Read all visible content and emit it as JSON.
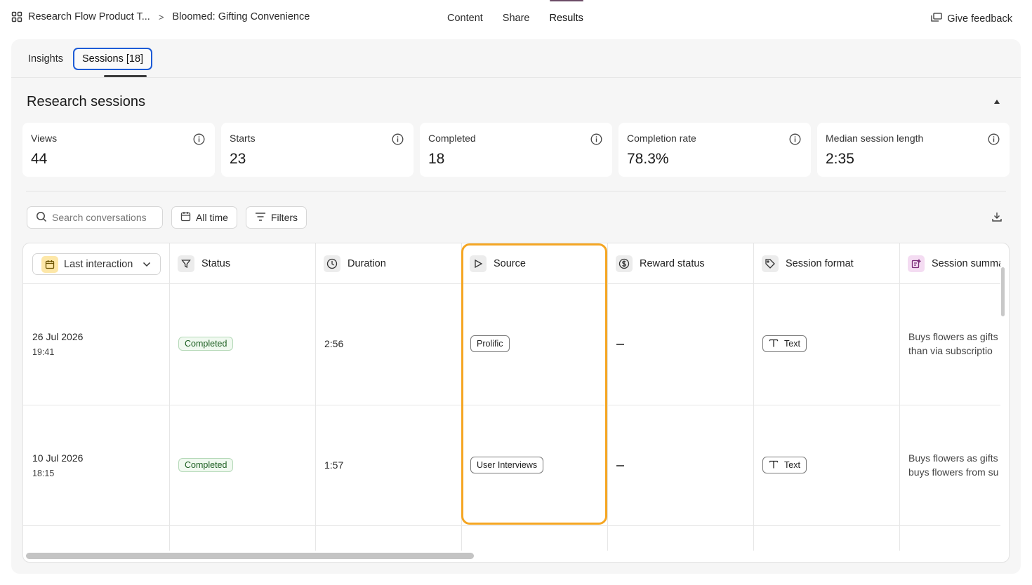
{
  "breadcrumb": {
    "project": "Research Flow Product T...",
    "separator": ">",
    "study": "Bloomed: Gifting Convenience"
  },
  "nav": {
    "tabs": [
      {
        "label": "Content",
        "active": false
      },
      {
        "label": "Share",
        "active": false
      },
      {
        "label": "Results",
        "active": true
      }
    ],
    "feedback_label": "Give feedback"
  },
  "subtabs": [
    {
      "label": "Insights",
      "active": false
    },
    {
      "label": "Sessions [18]",
      "active": true
    }
  ],
  "section": {
    "title": "Research sessions"
  },
  "stats": [
    {
      "label": "Views",
      "value": "44"
    },
    {
      "label": "Starts",
      "value": "23"
    },
    {
      "label": "Completed",
      "value": "18"
    },
    {
      "label": "Completion rate",
      "value": "78.3%"
    },
    {
      "label": "Median session length",
      "value": "2:35"
    }
  ],
  "toolbar": {
    "search_placeholder": "Search conversations",
    "time_label": "All time",
    "filters_label": "Filters"
  },
  "table": {
    "sort_label": "Last interaction",
    "columns": [
      "Status",
      "Duration",
      "Source",
      "Reward status",
      "Session format",
      "Session summa"
    ],
    "rows": [
      {
        "date": "26 Jul 2026",
        "time": "19:41",
        "status": "Completed",
        "duration": "2:56",
        "source": "Prolific",
        "reward": "—",
        "format": "Text",
        "summary_line1": "Buys flowers as gifts",
        "summary_line2": "than via subscriptio"
      },
      {
        "date": "10 Jul 2026",
        "time": "18:15",
        "status": "Completed",
        "duration": "1:57",
        "source": "User Interviews",
        "reward": "—",
        "format": "Text",
        "summary_line1": "Buys flowers as gifts",
        "summary_line2": "buys flowers from su"
      }
    ]
  },
  "colors": {
    "highlight": "#f5a623",
    "active_tab_outline": "#1d5bd6",
    "completed_badge": "#1b5e20"
  }
}
